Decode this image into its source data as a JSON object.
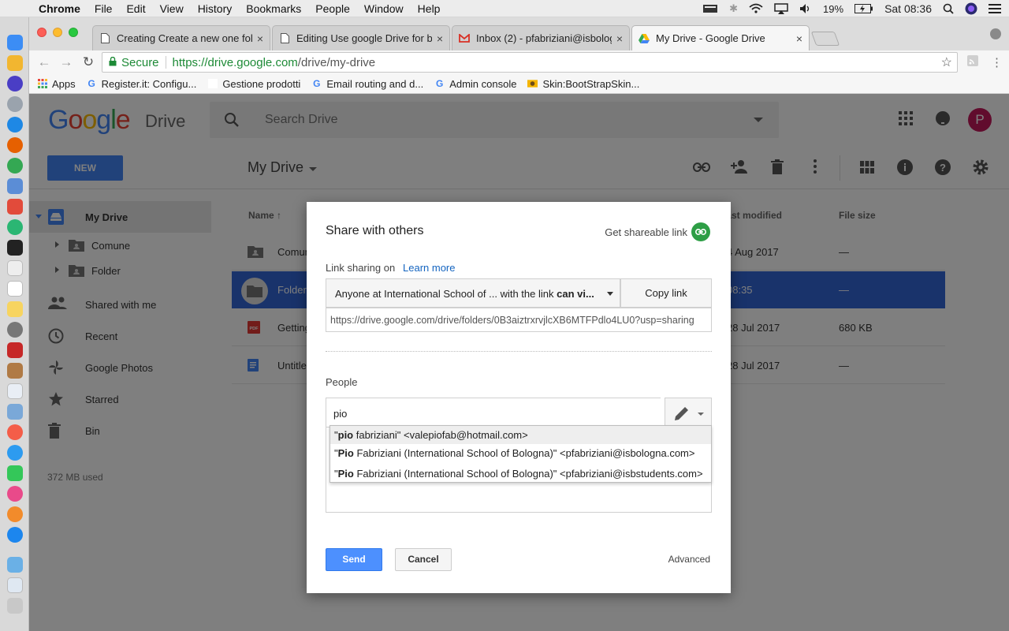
{
  "menubar": {
    "app": "Chrome",
    "items": [
      "File",
      "Edit",
      "View",
      "History",
      "Bookmarks",
      "People",
      "Window",
      "Help"
    ],
    "battery": "19%",
    "clock": "Sat 08:36"
  },
  "tabs": [
    {
      "title": "Creating Create a new one fold",
      "icon": "document-icon"
    },
    {
      "title": "Editing Use google Drive for br",
      "icon": "document-icon"
    },
    {
      "title": "Inbox (2) - pfabriziani@isbolog",
      "icon": "gmail-icon"
    },
    {
      "title": "My Drive - Google Drive",
      "icon": "drive-icon"
    }
  ],
  "toolbar": {
    "secure_label": "Secure",
    "url_host": "https://drive.google.com",
    "url_path": "/drive/my-drive"
  },
  "bookmarks": [
    {
      "label": "Apps"
    },
    {
      "label": "Register.it: Configu..."
    },
    {
      "label": "Gestione prodotti"
    },
    {
      "label": "Email routing and d..."
    },
    {
      "label": "Admin console"
    },
    {
      "label": "Skin:BootStrapSkin..."
    }
  ],
  "drive": {
    "logo_google": "Google",
    "logo_drive": "Drive",
    "search_placeholder": "Search Drive",
    "avatar_letter": "P",
    "new_label": "NEW",
    "title": "My Drive",
    "sidebar": {
      "my_drive": "My Drive",
      "sub": [
        "Comune",
        "Folder"
      ],
      "items": [
        "Shared with me",
        "Recent",
        "Google Photos",
        "Starred",
        "Bin"
      ],
      "storage": "372 MB used"
    },
    "columns": {
      "name": "Name",
      "modified": "Last modified",
      "size": "File size"
    },
    "files": [
      {
        "name": "Comune",
        "modified": "4 Aug 2017",
        "size": "—"
      },
      {
        "name": "Folder",
        "modified": "08:35",
        "size": "—"
      },
      {
        "name": "Getting started",
        "modified": "28 Jul 2017",
        "size": "680 KB"
      },
      {
        "name": "Untitled document",
        "modified": "28 Jul 2017",
        "size": "—"
      }
    ]
  },
  "dialog": {
    "title": "Share with others",
    "shareable_link": "Get shareable link",
    "link_sharing": "Link sharing on",
    "learn_more": "Learn more",
    "permission_prefix": "Anyone at International School of ... with the link ",
    "permission_bold": "can vi...",
    "copy_link": "Copy link",
    "link_url": "https://drive.google.com/drive/folders/0B3aiztrxrvjlcXB6MTFPdlo4LU0?usp=sharing",
    "people_label": "People",
    "people_value": "pio",
    "suggestions": [
      {
        "pre": "\"",
        "bold": "pio",
        "rest": " fabriziani\" <valepiofab@hotmail.com>"
      },
      {
        "pre": "\"",
        "bold": "Pio",
        "rest": " Fabriziani (International School of Bologna)\" <pfabriziani@isbologna.com>"
      },
      {
        "pre": "\"",
        "bold": "Pio",
        "rest": " Fabriziani (International School of Bologna)\" <pfabriziani@isbstudents.com>"
      }
    ],
    "send": "Send",
    "cancel": "Cancel",
    "advanced": "Advanced"
  }
}
